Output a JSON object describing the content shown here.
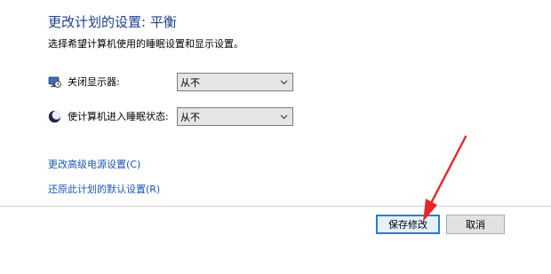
{
  "page": {
    "title": "更改计划的设置: 平衡",
    "subtitle": "选择希望计算机使用的睡眠设置和显示设置。"
  },
  "settings": {
    "display_off": {
      "label": "关闭显示器:",
      "value": "从不",
      "icon": "monitor-clock-icon"
    },
    "sleep": {
      "label": "使计算机进入睡眠状态:",
      "value": "从不",
      "icon": "moon-sleep-icon"
    }
  },
  "links": {
    "advanced": "更改高级电源设置(C)",
    "restore": "还原此计划的默认设置(R)"
  },
  "buttons": {
    "save": "保存修改",
    "cancel": "取消"
  },
  "annotation": {
    "arrow_color": "#e8262a"
  },
  "colors": {
    "title": "#1e3f8a",
    "link": "#1a56b6",
    "primary_button_border": "#2b7bd6"
  }
}
